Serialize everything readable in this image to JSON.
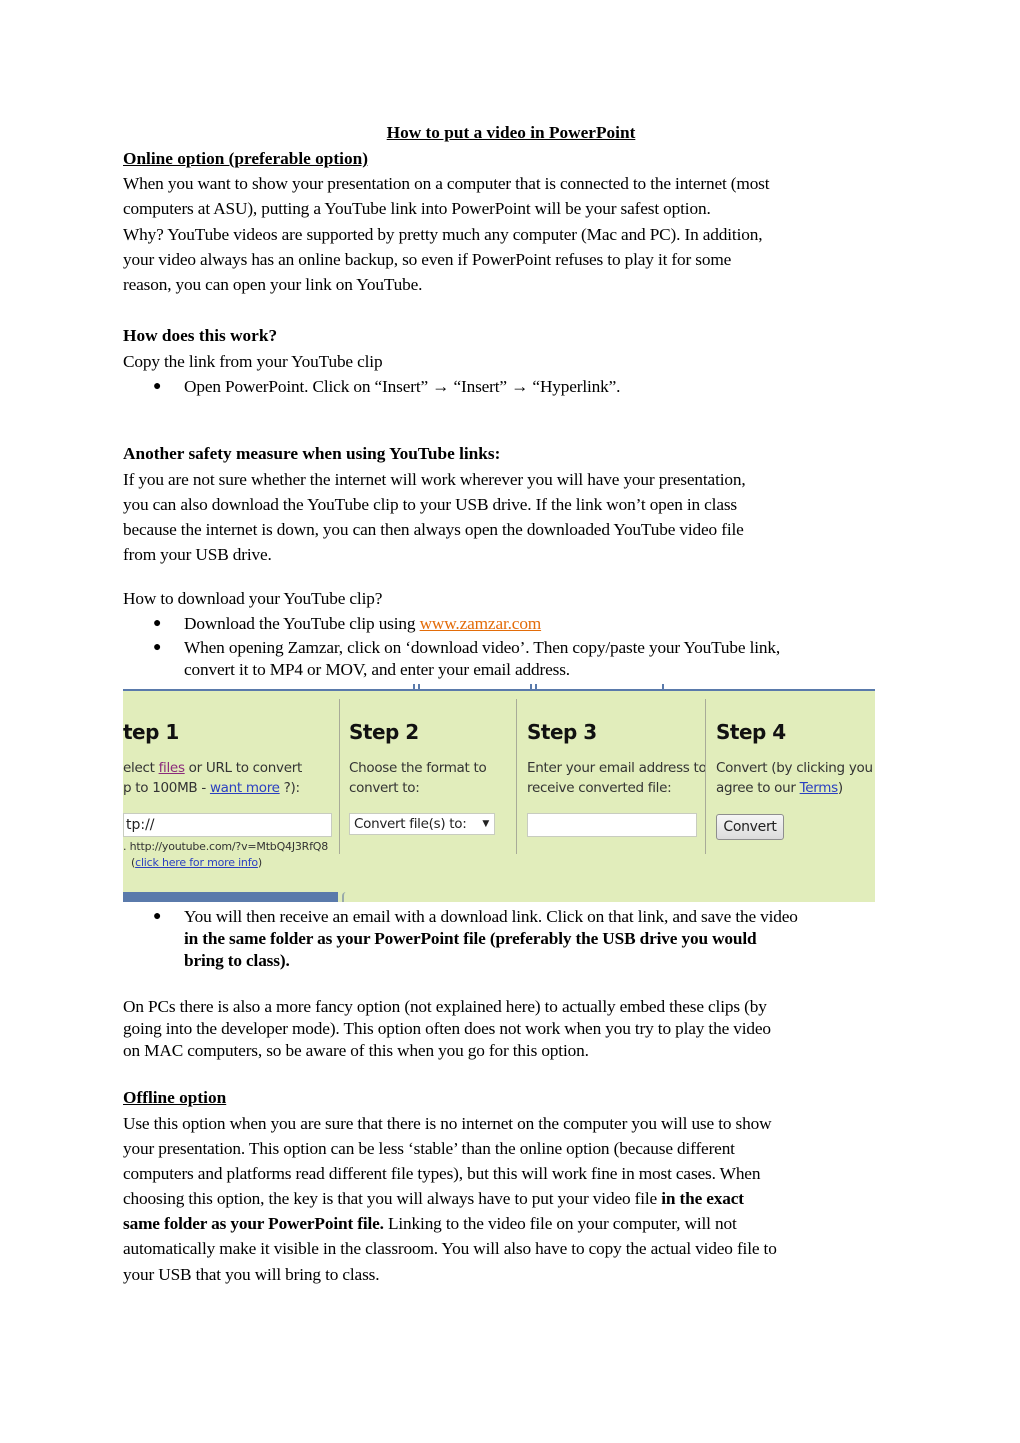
{
  "document": {
    "title": "How to put a video in PowerPoint",
    "online_section": {
      "heading": "Online option (preferable option)",
      "paragraph_lines": [
        "When you want to show your presentation on a computer that is connected to the internet (most",
        "computers at ASU), putting a YouTube  link into PowerPoint will be your safest option.",
        "Why? YouTube videos are supported by pretty much any computer (Mac and PC). In addition,",
        "your video always has an online backup, so even if PowerPoint refuses to play it for some",
        "reason, you can open your link on YouTube."
      ]
    },
    "how_section": {
      "heading": "How does this work?",
      "intro": "Copy the link from your YouTube clip",
      "bullets": [
        "Open PowerPoint. Click on “Insert” → “Insert” → “Hyperlink”."
      ]
    },
    "safety_section": {
      "heading": "Another safety measure when using YouTube links:",
      "paragraph_lines": [
        "If you are not sure whether the internet will work wherever you will have your presentation,",
        "you can also download the YouTube clip to your USB drive. If the link won’t open in class",
        "because the internet is down, you can then always open the downloaded YouTube video file",
        "from your USB drive."
      ]
    },
    "download_section": {
      "question": "How to download your YouTube clip?",
      "bullet1_text": "Download the YouTube clip using ",
      "bullet1_link": "www.zamzar.com",
      "bullet2_lines": [
        "When opening Zamzar, click on ‘download video’. Then copy/paste your YouTube link,",
        "convert it to MP4 or MOV, and enter your email address."
      ],
      "bullet3_line1": "You will then receive an email with a download link. Click on that link, and save the video",
      "bullet3_bold_lines": [
        "in the same folder as your PowerPoint file (preferably the USB drive you would",
        "bring to class)."
      ]
    },
    "embed_paragraph_lines": [
      "On PCs there is also a more fancy option (not explained here) to actually embed these clips (by",
      "going into the developer mode). This option often does not work when you try to play the video",
      "on MAC computers, so be aware of this when you go for this option."
    ],
    "offline_section": {
      "heading": "Offline option",
      "lines": [
        "Use this option when you are sure that there is no internet on the computer you will use to show",
        "your presentation. This option can be less ‘stable’ than the online option (because different",
        "computers and platforms read different file types), but this will work fine in most cases. When"
      ],
      "line4_normal": "choosing this option, the key is that you will always have to put your video file ",
      "line4_bold": "in the exact",
      "line5_bold": "same folder as your  PowerPoint file.",
      "line5_normal": " Linking to the video file on your computer, will not",
      "lines_after": [
        "automatically make it visible in the classroom. You will also have to copy the actual video file to",
        "your USB that you will bring to class."
      ]
    }
  },
  "zamzar_screenshot": {
    "background_color": "#e1edbb",
    "steps": [
      {
        "title": "tep 1",
        "desc_line1_pre": "elect ",
        "desc_line1_link": "files",
        "desc_line1_post": " or URL to convert",
        "desc_line2_pre": "p to 100MB - ",
        "desc_line2_link": "want more",
        "desc_line2_post": " ?):",
        "input_value": "tp://",
        "hint_line1": ". http://youtube.com/?v=MtbQ4J3RfQ8",
        "hint_line2_pre": "(",
        "hint_line2_link": "click here for more info",
        "hint_line2_post": ")"
      },
      {
        "title": "Step 2",
        "desc_lines": [
          "Choose the format to",
          "convert to:"
        ],
        "select_value": "Convert file(s) to:",
        "select_arrow": "▼"
      },
      {
        "title": "Step 3",
        "desc_lines": [
          "Enter your email address to",
          "receive converted file:"
        ],
        "email_value": ""
      },
      {
        "title": "Step 4",
        "desc_line1": "Convert (by clicking you",
        "desc_line2_pre": "agree to our ",
        "desc_line2_link": "Terms",
        "desc_line2_post": ")",
        "button_label": "Convert"
      }
    ]
  }
}
